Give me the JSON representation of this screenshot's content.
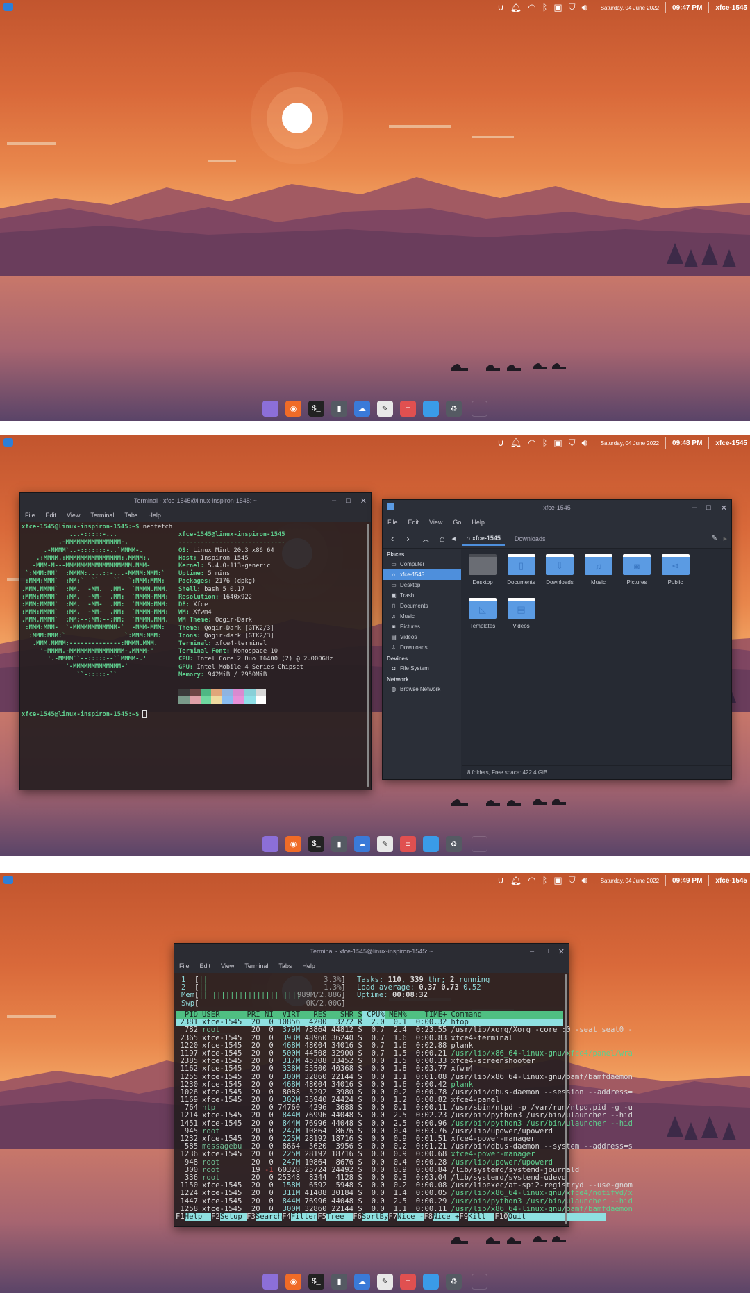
{
  "screens": [
    {
      "date": "Saturday, 04 June 2022",
      "time": "09:47 PM",
      "user": "xfce-1545"
    },
    {
      "date": "Saturday, 04 June 2022",
      "time": "09:48 PM",
      "user": "xfce-1545"
    },
    {
      "date": "Saturday, 04 June 2022",
      "time": "09:49 PM",
      "user": "xfce-1545"
    }
  ],
  "tray_icons": [
    "ulauncher-icon",
    "bell-icon",
    "wifi-icon",
    "bluetooth-icon",
    "clipboard-icon",
    "shield-icon",
    "volume-icon"
  ],
  "dock": [
    {
      "name": "files",
      "color": "#8c6fd8",
      "glyph": ""
    },
    {
      "name": "firefox",
      "color": "#f06b27",
      "glyph": "◉"
    },
    {
      "name": "terminal",
      "color": "#222",
      "glyph": "$_"
    },
    {
      "name": "android",
      "color": "#555a63",
      "glyph": "▮"
    },
    {
      "name": "thunderbird",
      "color": "#3a7ad8",
      "glyph": "☁"
    },
    {
      "name": "text-editor",
      "color": "#e8e8e8",
      "glyph": "✎"
    },
    {
      "name": "calculator",
      "color": "#e05050",
      "glyph": "±"
    },
    {
      "name": "desktop",
      "color": "#3a9be8",
      "glyph": ""
    },
    {
      "name": "trash",
      "color": "#555a63",
      "glyph": "♻"
    }
  ],
  "terminal1": {
    "title": "Terminal - xfce-1545@linux-inspiron-1545: ~",
    "menu": [
      "File",
      "Edit",
      "View",
      "Terminal",
      "Tabs",
      "Help"
    ],
    "prompt": "xfce-1545@linux-inspiron-1545:~$",
    "command": " neofetch",
    "logo": [
      "             ...-:::::-...",
      "          .-MMMMMMMMMMMMMMM-.",
      "      .-MMMM`..-:::::::-..`MMMM-.",
      "    .:MMMM.:MMMMMMMMMMMMMMM:.MMMM:.",
      "   -MMM-M---MMMMMMMMMMMMMMMMMM.MMM-",
      " `:MMM:MM`  :MMMM:....::-...-MMMM:MMM:`",
      " :MMM:MMM`  :MM:`  ``    ``  `:MMM:MMM:",
      ".MMM.MMMM`  :MM.  -MM.  .MM-  `MMMM.MMM.",
      ":MMM:MMMM`  :MM.  -MM-  .MM:  `MMMM-MMM:",
      ":MMM:MMMM`  :MM.  -MM-  .MM:  `MMMM:MMM:",
      ":MMM:MMMM`  :MM.  -MM-  .MM:  `MMMM-MMM:",
      ".MMM.MMMM`  :MM:--:MM:--:MM:  `MMMM.MMM.",
      " :MMM:MMM-  `-MMMMMMMMMMMM-`  -MMM-MMM:",
      "  :MMM:MMM:`                `:MMM:MMM:",
      "   .MMM.MMMM:--------------:MMMM.MMM.",
      "     '-MMMM.-MMMMMMMMMMMMMMM-.MMMM-'",
      "       '.-MMMM``--:::::--``MMMM-.'",
      "            '-MMMMMMMMMMMMM-'",
      "               ``-:::::-``"
    ],
    "header": "xfce-1545@linux-inspiron-1545",
    "underline": "-----------------------------",
    "info": [
      {
        "k": "OS",
        "v": "Linux Mint 20.3 x86_64"
      },
      {
        "k": "Host",
        "v": "Inspiron 1545"
      },
      {
        "k": "Kernel",
        "v": "5.4.0-113-generic"
      },
      {
        "k": "Uptime",
        "v": "5 mins"
      },
      {
        "k": "Packages",
        "v": "2176 (dpkg)"
      },
      {
        "k": "Shell",
        "v": "bash 5.0.17"
      },
      {
        "k": "Resolution",
        "v": "1640x922"
      },
      {
        "k": "DE",
        "v": "Xfce"
      },
      {
        "k": "WM",
        "v": "Xfwm4"
      },
      {
        "k": "WM Theme",
        "v": "Qogir-Dark"
      },
      {
        "k": "Theme",
        "v": "Qogir-Dark [GTK2/3]"
      },
      {
        "k": "Icons",
        "v": "Qogir-dark [GTK2/3]"
      },
      {
        "k": "Terminal",
        "v": "xfce4-terminal"
      },
      {
        "k": "Terminal Font",
        "v": "Monospace 10"
      },
      {
        "k": "CPU",
        "v": "Intel Core 2 Duo T6400 (2) @ 2.000GHz"
      },
      {
        "k": "GPU",
        "v": "Intel Mobile 4 Series Chipset"
      },
      {
        "k": "Memory",
        "v": "942MiB / 2950MiB"
      }
    ],
    "palette_top": [
      "#3a3a3a",
      "#6e4444",
      "#4fb884",
      "#e0a57a",
      "#8fb4e0",
      "#d98ad0",
      "#88d0d8",
      "#d8d8d8"
    ],
    "palette_bottom": [
      "#7a9a8a",
      "#e0a0a8",
      "#70d8a0",
      "#eedaa0",
      "#8abcf0",
      "#e890d8",
      "#90e0e8",
      "#ffffff"
    ]
  },
  "filemanager": {
    "title": "xfce-1545",
    "menu": [
      "File",
      "Edit",
      "View",
      "Go",
      "Help"
    ],
    "path": [
      "xfce-1545",
      "Downloads"
    ],
    "sections": [
      {
        "title": "Places",
        "items": [
          {
            "label": "Computer",
            "icon": "computer-icon",
            "glyph": "▭"
          },
          {
            "label": "xfce-1545",
            "icon": "home-icon",
            "glyph": "⌂",
            "selected": true
          },
          {
            "label": "Desktop",
            "icon": "desktop-icon",
            "glyph": "▭"
          },
          {
            "label": "Trash",
            "icon": "trash-icon",
            "glyph": "▣"
          },
          {
            "label": "Documents",
            "icon": "document-icon",
            "glyph": "▯"
          },
          {
            "label": "Music",
            "icon": "music-icon",
            "glyph": "♫"
          },
          {
            "label": "Pictures",
            "icon": "camera-icon",
            "glyph": "◙"
          },
          {
            "label": "Videos",
            "icon": "film-icon",
            "glyph": "▤"
          },
          {
            "label": "Downloads",
            "icon": "download-icon",
            "glyph": "⇩"
          }
        ]
      },
      {
        "title": "Devices",
        "items": [
          {
            "label": "File System",
            "icon": "drive-icon",
            "glyph": "◘"
          }
        ]
      },
      {
        "title": "Network",
        "items": [
          {
            "label": "Browse Network",
            "icon": "network-icon",
            "glyph": "◍"
          }
        ]
      }
    ],
    "folders": [
      {
        "label": "Desktop",
        "glyph": "",
        "icon": "desktop-folder-icon"
      },
      {
        "label": "Documents",
        "glyph": "▯",
        "icon": "documents-folder-icon"
      },
      {
        "label": "Downloads",
        "glyph": "⇩",
        "icon": "downloads-folder-icon"
      },
      {
        "label": "Music",
        "glyph": "♫",
        "icon": "music-folder-icon"
      },
      {
        "label": "Pictures",
        "glyph": "◙",
        "icon": "pictures-folder-icon"
      },
      {
        "label": "Public",
        "glyph": "⋖",
        "icon": "public-folder-icon"
      },
      {
        "label": "Templates",
        "glyph": "◺",
        "icon": "templates-folder-icon"
      },
      {
        "label": "Videos",
        "glyph": "▤",
        "icon": "videos-folder-icon"
      }
    ],
    "status": "8 folders, Free space: 422.4 GiB"
  },
  "terminal2": {
    "title": "Terminal - xfce-1545@linux-inspiron-1545: ~",
    "menu": [
      "File",
      "Edit",
      "View",
      "Terminal",
      "Tabs",
      "Help"
    ],
    "meters": [
      {
        "label": "1  ",
        "bar": "||",
        "value": "3.3%",
        "fill": 0.033
      },
      {
        "label": "2  ",
        "bar": "||",
        "value": "1.3%",
        "fill": 0.013
      },
      {
        "label": "Mem",
        "bar": "|||||||||||||||||||||||",
        "value": "989M/2.88G",
        "fill": 0.34
      },
      {
        "label": "Swp",
        "bar": "",
        "value": "0K/2.00G",
        "fill": 0
      }
    ],
    "tasks": {
      "label": "Tasks: ",
      "count": "110",
      "sep": ", ",
      "threads": "339",
      "rest": " thr; ",
      "running": "2",
      "running_label": " running"
    },
    "load": {
      "label": "Load average: ",
      "v1": "0.37",
      "v2": "0.73",
      "v3": "0.52"
    },
    "uptime": {
      "label": "Uptime: ",
      "value": "00:08:32"
    },
    "columns": [
      "PID",
      "USER",
      "PRI",
      "NI",
      "VIRT",
      "RES",
      "SHR",
      "S",
      "CPU%",
      "MEM%",
      "TIME+",
      "Command"
    ],
    "rows": [
      [
        "2381",
        "xfce-1545",
        "20",
        "0",
        "10856",
        "4200",
        "3272",
        "R",
        "2.0",
        "0.1",
        "0:00.32",
        "htop"
      ],
      [
        "782",
        "root",
        "20",
        "0",
        "379M",
        "73864",
        "44812",
        "S",
        "0.7",
        "2.4",
        "0:23.55",
        "/usr/lib/xorg/Xorg -core :0 -seat seat0 -"
      ],
      [
        "2365",
        "xfce-1545",
        "20",
        "0",
        "393M",
        "48960",
        "36240",
        "S",
        "0.7",
        "1.6",
        "0:00.83",
        "xfce4-terminal"
      ],
      [
        "1220",
        "xfce-1545",
        "20",
        "0",
        "468M",
        "48004",
        "34016",
        "S",
        "0.7",
        "1.6",
        "0:02.88",
        "plank"
      ],
      [
        "1197",
        "xfce-1545",
        "20",
        "0",
        "500M",
        "44508",
        "32900",
        "S",
        "0.7",
        "1.5",
        "0:00.21",
        "/usr/lib/x86_64-linux-gnu/xfce4/panel/wra"
      ],
      [
        "2385",
        "xfce-1545",
        "20",
        "0",
        "317M",
        "45308",
        "33452",
        "S",
        "0.0",
        "1.5",
        "0:00.33",
        "xfce4-screenshooter"
      ],
      [
        "1162",
        "xfce-1545",
        "20",
        "0",
        "338M",
        "55500",
        "40368",
        "S",
        "0.0",
        "1.8",
        "0:03.77",
        "xfwm4"
      ],
      [
        "1255",
        "xfce-1545",
        "20",
        "0",
        "300M",
        "32860",
        "22144",
        "S",
        "0.0",
        "1.1",
        "0:01.08",
        "/usr/lib/x86_64-linux-gnu/bamf/bamfdaemon"
      ],
      [
        "1230",
        "xfce-1545",
        "20",
        "0",
        "468M",
        "48004",
        "34016",
        "S",
        "0.0",
        "1.6",
        "0:00.42",
        "plank"
      ],
      [
        "1026",
        "xfce-1545",
        "20",
        "0",
        "8088",
        "5292",
        "3980",
        "S",
        "0.0",
        "0.2",
        "0:00.78",
        "/usr/bin/dbus-daemon --session --address="
      ],
      [
        "1169",
        "xfce-1545",
        "20",
        "0",
        "302M",
        "35940",
        "24424",
        "S",
        "0.0",
        "1.2",
        "0:00.82",
        "xfce4-panel"
      ],
      [
        "764",
        "ntp",
        "20",
        "0",
        "74760",
        "4296",
        "3688",
        "S",
        "0.0",
        "0.1",
        "0:00.11",
        "/usr/sbin/ntpd -p /var/run/ntpd.pid -g -u"
      ],
      [
        "1214",
        "xfce-1545",
        "20",
        "0",
        "844M",
        "76996",
        "44048",
        "S",
        "0.0",
        "2.5",
        "0:02.23",
        "/usr/bin/python3 /usr/bin/ulauncher --hid"
      ],
      [
        "1451",
        "xfce-1545",
        "20",
        "0",
        "844M",
        "76996",
        "44048",
        "S",
        "0.0",
        "2.5",
        "0:00.96",
        "/usr/bin/python3 /usr/bin/ulauncher --hid"
      ],
      [
        "945",
        "root",
        "20",
        "0",
        "247M",
        "10864",
        "8676",
        "S",
        "0.0",
        "0.4",
        "0:03.76",
        "/usr/lib/upower/upowerd"
      ],
      [
        "1232",
        "xfce-1545",
        "20",
        "0",
        "225M",
        "28192",
        "18716",
        "S",
        "0.0",
        "0.9",
        "0:01.51",
        "xfce4-power-manager"
      ],
      [
        "585",
        "messagebu",
        "20",
        "0",
        "8664",
        "5620",
        "3956",
        "S",
        "0.0",
        "0.2",
        "0:01.21",
        "/usr/bin/dbus-daemon --system --address=s"
      ],
      [
        "1236",
        "xfce-1545",
        "20",
        "0",
        "225M",
        "28192",
        "18716",
        "S",
        "0.0",
        "0.9",
        "0:00.68",
        "xfce4-power-manager"
      ],
      [
        "948",
        "root",
        "20",
        "0",
        "247M",
        "10864",
        "8676",
        "S",
        "0.0",
        "0.4",
        "0:00.28",
        "/usr/lib/upower/upowerd"
      ],
      [
        "300",
        "root",
        "19",
        "-1",
        "60328",
        "25724",
        "24492",
        "S",
        "0.0",
        "0.9",
        "0:00.84",
        "/lib/systemd/systemd-journald"
      ],
      [
        "336",
        "root",
        "20",
        "0",
        "25348",
        "8344",
        "4128",
        "S",
        "0.0",
        "0.3",
        "0:03.04",
        "/lib/systemd/systemd-udevd"
      ],
      [
        "1150",
        "xfce-1545",
        "20",
        "0",
        "158M",
        "6592",
        "5948",
        "S",
        "0.0",
        "0.2",
        "0:00.08",
        "/usr/libexec/at-spi2-registryd --use-gnom"
      ],
      [
        "1224",
        "xfce-1545",
        "20",
        "0",
        "311M",
        "41408",
        "30184",
        "S",
        "0.0",
        "1.4",
        "0:00.05",
        "/usr/lib/x86_64-linux-gnu/xfce4/notifyd/x"
      ],
      [
        "1447",
        "xfce-1545",
        "20",
        "0",
        "844M",
        "76996",
        "44048",
        "S",
        "0.0",
        "2.5",
        "0:00.29",
        "/usr/bin/python3 /usr/bin/ulauncher --hid"
      ],
      [
        "1258",
        "xfce-1545",
        "20",
        "0",
        "300M",
        "32860",
        "22144",
        "S",
        "0.0",
        "1.1",
        "0:00.11",
        "/usr/lib/x86_64-linux-gnu/bamf/bamfdaemon"
      ]
    ],
    "thread_rows": [
      4,
      8,
      13,
      17,
      18,
      22,
      23,
      24
    ],
    "fkeys": [
      {
        "k": "F1",
        "l": "Help  "
      },
      {
        "k": "F2",
        "l": "Setup "
      },
      {
        "k": "F3",
        "l": "Search"
      },
      {
        "k": "F4",
        "l": "Filter"
      },
      {
        "k": "F5",
        "l": "Tree  "
      },
      {
        "k": "F6",
        "l": "SortBy"
      },
      {
        "k": "F7",
        "l": "Nice -"
      },
      {
        "k": "F8",
        "l": "Nice +"
      },
      {
        "k": "F9",
        "l": "Kill  "
      },
      {
        "k": "F10",
        "l": "Quit                  "
      }
    ]
  }
}
